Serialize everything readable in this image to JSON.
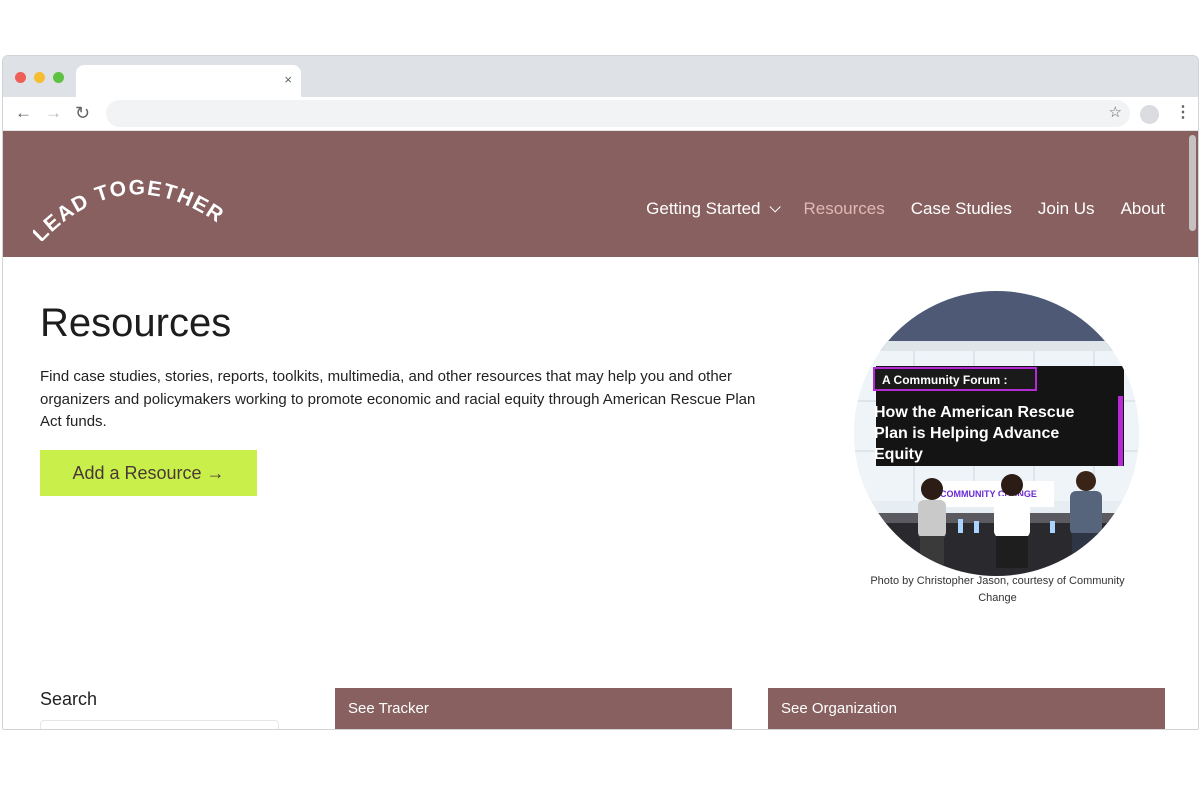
{
  "browser": {
    "tab_close": "×",
    "icons": {
      "back": "arrow-left",
      "forward": "arrow-right",
      "reload": "reload",
      "star": "star",
      "menu": "kebab"
    }
  },
  "site": {
    "logo_text": "LEAD TOGETHER",
    "nav": [
      {
        "label": "Getting Started",
        "has_dropdown": true
      },
      {
        "label": "Resources",
        "active": true
      },
      {
        "label": "Case Studies"
      },
      {
        "label": "Join Us"
      },
      {
        "label": "About"
      }
    ],
    "colors": {
      "header_bg": "#87605f",
      "active_nav": "#e2b8b5",
      "cta_bg": "#c9f04a"
    }
  },
  "main": {
    "title": "Resources",
    "intro": "Find case studies, stories, reports, toolkits, multimedia, and other resources that may help you and other organizers and policymakers working to promote economic and racial equity through American Rescue Plan Act funds.",
    "add_button": "Add a Resource →",
    "hero": {
      "screen_tag": "A Community Forum :",
      "screen_headline_lines": [
        "How the American Rescue",
        "Plan is Helping Advance",
        "Equity"
      ],
      "banner_text": "COMMUNITY CHANGE",
      "caption": "Photo by Christopher Jason, courtesy of Community Change"
    }
  },
  "filters": {
    "search_label": "Search",
    "cards": [
      "See Tracker",
      "See Organization"
    ]
  }
}
